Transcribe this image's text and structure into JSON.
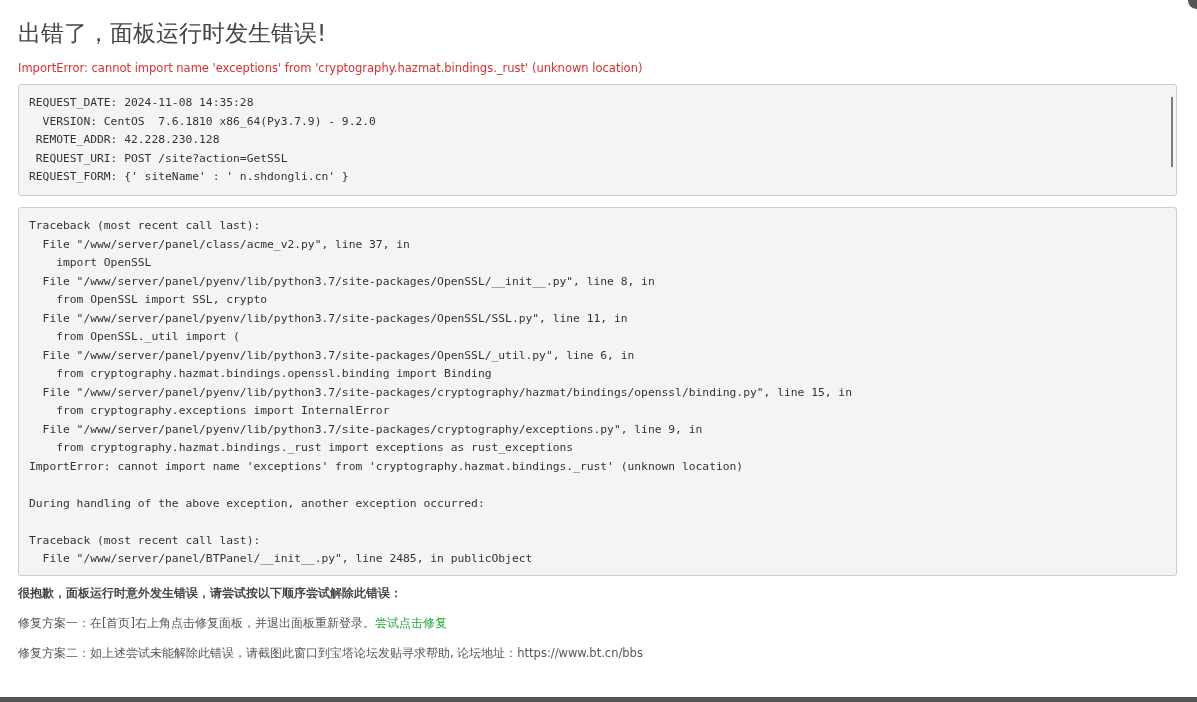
{
  "title": "出错了，面板运行时发生错误!",
  "error_message": "ImportError: cannot import name 'exceptions' from 'cryptography.hazmat.bindings._rust' (unknown location)",
  "request_info": [
    "REQUEST_DATE: 2024-11-08 14:35:28",
    "  VERSION: CentOS  7.6.1810 x86_64(Py3.7.9) - 9.2.0",
    " REMOTE_ADDR: 42.228.230.128",
    " REQUEST_URI: POST /site?action=GetSSL",
    "REQUEST_FORM: {' siteName' : ' n.shdongli.cn' }"
  ],
  "traceback": [
    [
      "Traceback (most recent call last):",
      "  File \"/www/server/panel/class/acme_v2.py\", line 37, in",
      "    import OpenSSL",
      "  File \"/www/server/panel/pyenv/lib/python3.7/site-packages/OpenSSL/__init__.py\", line 8, in",
      "    from OpenSSL import SSL, crypto",
      "  File \"/www/server/panel/pyenv/lib/python3.7/site-packages/OpenSSL/SSL.py\", line 11, in",
      "    from OpenSSL._util import (",
      "  File \"/www/server/panel/pyenv/lib/python3.7/site-packages/OpenSSL/_util.py\", line 6, in",
      "    from cryptography.hazmat.bindings.openssl.binding import Binding",
      "  File \"/www/server/panel/pyenv/lib/python3.7/site-packages/cryptography/hazmat/bindings/openssl/binding.py\", line 15, in",
      "    from cryptography.exceptions import InternalError",
      "  File \"/www/server/panel/pyenv/lib/python3.7/site-packages/cryptography/exceptions.py\", line 9, in",
      "    from cryptography.hazmat.bindings._rust import exceptions as rust_exceptions",
      "ImportError: cannot import name 'exceptions' from 'cryptography.hazmat.bindings._rust' (unknown location)"
    ],
    [
      "During handling of the above exception, another exception occurred:"
    ],
    [
      "Traceback (most recent call last):",
      "  File \"/www/server/panel/BTPanel/__init__.py\", line 2485, in publicObject"
    ]
  ],
  "help_heading": "很抱歉，面板运行时意外发生错误，请尝试按以下顺序尝试解除此错误：",
  "fix_1": {
    "text": "修复方案一：在[首页]右上角点击修复面板，并退出面板重新登录。",
    "link": "尝试点击修复"
  },
  "fix_2": "修复方案二：如上述尝试未能解除此错误，请截图此窗口到宝塔论坛发贴寻求帮助, 论坛地址：https://www.bt.cn/bbs"
}
